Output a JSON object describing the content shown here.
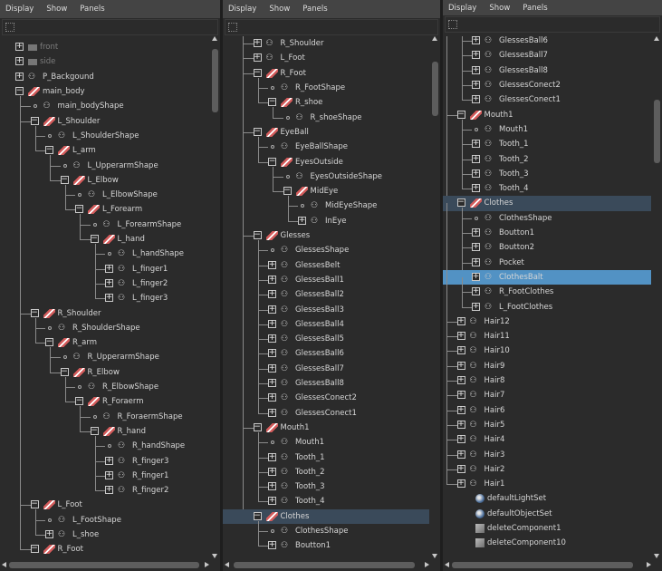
{
  "menu": [
    "Display",
    "Show",
    "Panels"
  ],
  "panels": [
    {
      "rows": [
        {
          "d": 0,
          "t": "plus",
          "i": "camera",
          "l": "front",
          "dim": true
        },
        {
          "d": 0,
          "t": "plus",
          "i": "camera",
          "l": "side",
          "dim": true
        },
        {
          "d": 0,
          "t": "plus",
          "i": "shape",
          "l": "P_Backgound"
        },
        {
          "d": 0,
          "t": "minus",
          "i": "transform",
          "l": "main_body"
        },
        {
          "d": 1,
          "t": "dot",
          "i": "shape",
          "l": "main_bodyShape"
        },
        {
          "d": 1,
          "t": "minus",
          "i": "transform",
          "l": "L_Shoulder"
        },
        {
          "d": 2,
          "t": "dot",
          "i": "shape",
          "l": "L_ShoulderShape"
        },
        {
          "d": 2,
          "t": "minus",
          "i": "transform",
          "l": "L_arm"
        },
        {
          "d": 3,
          "t": "dot",
          "i": "shape",
          "l": "L_UpperarmShape"
        },
        {
          "d": 3,
          "t": "minus",
          "i": "transform",
          "l": "L_Elbow"
        },
        {
          "d": 4,
          "t": "dot",
          "i": "shape",
          "l": "L_ElbowShape"
        },
        {
          "d": 4,
          "t": "minus",
          "i": "transform",
          "l": "L_Forearm"
        },
        {
          "d": 5,
          "t": "dot",
          "i": "shape",
          "l": "L_ForearmShape"
        },
        {
          "d": 5,
          "t": "minus",
          "i": "transform",
          "l": "L_hand"
        },
        {
          "d": 6,
          "t": "dot",
          "i": "shape",
          "l": "L_handShape"
        },
        {
          "d": 6,
          "t": "plus",
          "i": "shape",
          "l": "L_finger1"
        },
        {
          "d": 6,
          "t": "plus",
          "i": "shape",
          "l": "L_finger2"
        },
        {
          "d": 6,
          "t": "plus",
          "i": "shape",
          "l": "L_finger3"
        },
        {
          "d": 1,
          "t": "minus",
          "i": "transform",
          "l": "R_Shoulder"
        },
        {
          "d": 2,
          "t": "dot",
          "i": "shape",
          "l": "R_ShoulderShape"
        },
        {
          "d": 2,
          "t": "minus",
          "i": "transform",
          "l": "R_arm"
        },
        {
          "d": 3,
          "t": "dot",
          "i": "shape",
          "l": "R_UpperarmShape"
        },
        {
          "d": 3,
          "t": "minus",
          "i": "transform",
          "l": "R_Elbow"
        },
        {
          "d": 4,
          "t": "dot",
          "i": "shape",
          "l": "R_ElbowShape"
        },
        {
          "d": 4,
          "t": "minus",
          "i": "transform",
          "l": "R_Foraerm"
        },
        {
          "d": 5,
          "t": "dot",
          "i": "shape",
          "l": "R_ForaermShape"
        },
        {
          "d": 5,
          "t": "minus",
          "i": "transform",
          "l": "R_hand"
        },
        {
          "d": 6,
          "t": "dot",
          "i": "shape",
          "l": "R_handShape"
        },
        {
          "d": 6,
          "t": "plus",
          "i": "shape",
          "l": "R_finger3"
        },
        {
          "d": 6,
          "t": "plus",
          "i": "shape",
          "l": "R_finger1"
        },
        {
          "d": 6,
          "t": "plus",
          "i": "shape",
          "l": "R_finger2"
        },
        {
          "d": 1,
          "t": "minus",
          "i": "transform",
          "l": "L_Foot"
        },
        {
          "d": 2,
          "t": "dot",
          "i": "shape",
          "l": "L_FootShape"
        },
        {
          "d": 2,
          "t": "plus",
          "i": "shape",
          "l": "L_shoe"
        },
        {
          "d": 1,
          "t": "minus",
          "i": "transform",
          "l": "R_Foot"
        }
      ]
    },
    {
      "rows": [
        {
          "d": 1,
          "t": "plus",
          "i": "shape",
          "l": "R_Shoulder"
        },
        {
          "d": 1,
          "t": "plus",
          "i": "shape",
          "l": "L_Foot"
        },
        {
          "d": 1,
          "t": "minus",
          "i": "transform",
          "l": "R_Foot"
        },
        {
          "d": 2,
          "t": "dot",
          "i": "shape",
          "l": "R_FootShape"
        },
        {
          "d": 2,
          "t": "minus",
          "i": "transform",
          "l": "R_shoe"
        },
        {
          "d": 3,
          "t": "dot",
          "i": "shape",
          "l": "R_shoeShape"
        },
        {
          "d": 1,
          "t": "minus",
          "i": "transform",
          "l": "EyeBall"
        },
        {
          "d": 2,
          "t": "dot",
          "i": "shape",
          "l": "EyeBallShape"
        },
        {
          "d": 2,
          "t": "minus",
          "i": "transform",
          "l": "EyesOutside"
        },
        {
          "d": 3,
          "t": "dot",
          "i": "shape",
          "l": "EyesOutsideShape"
        },
        {
          "d": 3,
          "t": "minus",
          "i": "transform",
          "l": "MidEye"
        },
        {
          "d": 4,
          "t": "dot",
          "i": "shape",
          "l": "MidEyeShape"
        },
        {
          "d": 4,
          "t": "plus",
          "i": "shape",
          "l": "InEye"
        },
        {
          "d": 1,
          "t": "minus",
          "i": "transform",
          "l": "Glesses"
        },
        {
          "d": 2,
          "t": "dot",
          "i": "shape",
          "l": "GlessesShape"
        },
        {
          "d": 2,
          "t": "plus",
          "i": "shape",
          "l": "GlessesBelt"
        },
        {
          "d": 2,
          "t": "plus",
          "i": "shape",
          "l": "GlessesBall1"
        },
        {
          "d": 2,
          "t": "plus",
          "i": "shape",
          "l": "GlessesBall2"
        },
        {
          "d": 2,
          "t": "plus",
          "i": "shape",
          "l": "GlessesBall3"
        },
        {
          "d": 2,
          "t": "plus",
          "i": "shape",
          "l": "GlessesBall4"
        },
        {
          "d": 2,
          "t": "plus",
          "i": "shape",
          "l": "GlessesBall5"
        },
        {
          "d": 2,
          "t": "plus",
          "i": "shape",
          "l": "GlessesBall6"
        },
        {
          "d": 2,
          "t": "plus",
          "i": "shape",
          "l": "GlessesBall7"
        },
        {
          "d": 2,
          "t": "plus",
          "i": "shape",
          "l": "GlessesBall8"
        },
        {
          "d": 2,
          "t": "plus",
          "i": "shape",
          "l": "GlessesConect2"
        },
        {
          "d": 2,
          "t": "plus",
          "i": "shape",
          "l": "GlessesConect1"
        },
        {
          "d": 1,
          "t": "minus",
          "i": "transform",
          "l": "Mouth1"
        },
        {
          "d": 2,
          "t": "dot",
          "i": "shape",
          "l": "Mouth1"
        },
        {
          "d": 2,
          "t": "plus",
          "i": "shape",
          "l": "Tooth_1"
        },
        {
          "d": 2,
          "t": "plus",
          "i": "shape",
          "l": "Tooth_2"
        },
        {
          "d": 2,
          "t": "plus",
          "i": "shape",
          "l": "Tooth_3"
        },
        {
          "d": 2,
          "t": "plus",
          "i": "shape",
          "l": "Tooth_4"
        },
        {
          "d": 1,
          "t": "minus",
          "i": "transform",
          "l": "Clothes",
          "hi": true
        },
        {
          "d": 2,
          "t": "dot",
          "i": "shape",
          "l": "ClothesShape"
        },
        {
          "d": 2,
          "t": "plus",
          "i": "shape",
          "l": "Boutton1"
        }
      ]
    },
    {
      "rows": [
        {
          "d": 2,
          "t": "plus",
          "i": "shape",
          "l": "GlessesBall6"
        },
        {
          "d": 2,
          "t": "plus",
          "i": "shape",
          "l": "GlessesBall7"
        },
        {
          "d": 2,
          "t": "plus",
          "i": "shape",
          "l": "GlessesBall8"
        },
        {
          "d": 2,
          "t": "plus",
          "i": "shape",
          "l": "GlessesConect2"
        },
        {
          "d": 2,
          "t": "plus",
          "i": "shape",
          "l": "GlessesConect1"
        },
        {
          "d": 1,
          "t": "minus",
          "i": "transform",
          "l": "Mouth1"
        },
        {
          "d": 2,
          "t": "dot",
          "i": "shape",
          "l": "Mouth1"
        },
        {
          "d": 2,
          "t": "plus",
          "i": "shape",
          "l": "Tooth_1"
        },
        {
          "d": 2,
          "t": "plus",
          "i": "shape",
          "l": "Tooth_2"
        },
        {
          "d": 2,
          "t": "plus",
          "i": "shape",
          "l": "Tooth_3"
        },
        {
          "d": 2,
          "t": "plus",
          "i": "shape",
          "l": "Tooth_4"
        },
        {
          "d": 1,
          "t": "minus",
          "i": "transform",
          "l": "Clothes",
          "hi": true
        },
        {
          "d": 2,
          "t": "dot",
          "i": "shape",
          "l": "ClothesShape"
        },
        {
          "d": 2,
          "t": "plus",
          "i": "shape",
          "l": "Boutton1"
        },
        {
          "d": 2,
          "t": "plus",
          "i": "shape",
          "l": "Boutton2"
        },
        {
          "d": 2,
          "t": "plus",
          "i": "shape",
          "l": "Pocket"
        },
        {
          "d": 2,
          "t": "plus",
          "i": "shape",
          "l": "ClothesBalt",
          "sel": true
        },
        {
          "d": 2,
          "t": "plus",
          "i": "shape",
          "l": "R_FootClothes"
        },
        {
          "d": 2,
          "t": "plus",
          "i": "shape",
          "l": "L_FootClothes"
        },
        {
          "d": 1,
          "t": "plus",
          "i": "shape",
          "l": "Hair12"
        },
        {
          "d": 1,
          "t": "plus",
          "i": "shape",
          "l": "Hair11"
        },
        {
          "d": 1,
          "t": "plus",
          "i": "shape",
          "l": "Hair10"
        },
        {
          "d": 1,
          "t": "plus",
          "i": "shape",
          "l": "Hair9"
        },
        {
          "d": 1,
          "t": "plus",
          "i": "shape",
          "l": "Hair8"
        },
        {
          "d": 1,
          "t": "plus",
          "i": "shape",
          "l": "Hair7"
        },
        {
          "d": 1,
          "t": "plus",
          "i": "shape",
          "l": "Hair6"
        },
        {
          "d": 1,
          "t": "plus",
          "i": "shape",
          "l": "Hair5"
        },
        {
          "d": 1,
          "t": "plus",
          "i": "shape",
          "l": "Hair4"
        },
        {
          "d": 1,
          "t": "plus",
          "i": "shape",
          "l": "Hair3"
        },
        {
          "d": 1,
          "t": "plus",
          "i": "shape",
          "l": "Hair2"
        },
        {
          "d": 1,
          "t": "plus",
          "i": "shape",
          "l": "Hair1"
        },
        {
          "d": 0,
          "t": "none",
          "i": "set",
          "l": "defaultLightSet"
        },
        {
          "d": 0,
          "t": "none",
          "i": "set",
          "l": "defaultObjectSet"
        },
        {
          "d": 0,
          "t": "none",
          "i": "comp",
          "l": "deleteComponent1"
        },
        {
          "d": 0,
          "t": "none",
          "i": "comp",
          "l": "deleteComponent10"
        }
      ]
    }
  ],
  "colors": {
    "selected": "#5292c4",
    "highlight": "#3a4a5a",
    "transform_icon": "#d45b5b"
  }
}
